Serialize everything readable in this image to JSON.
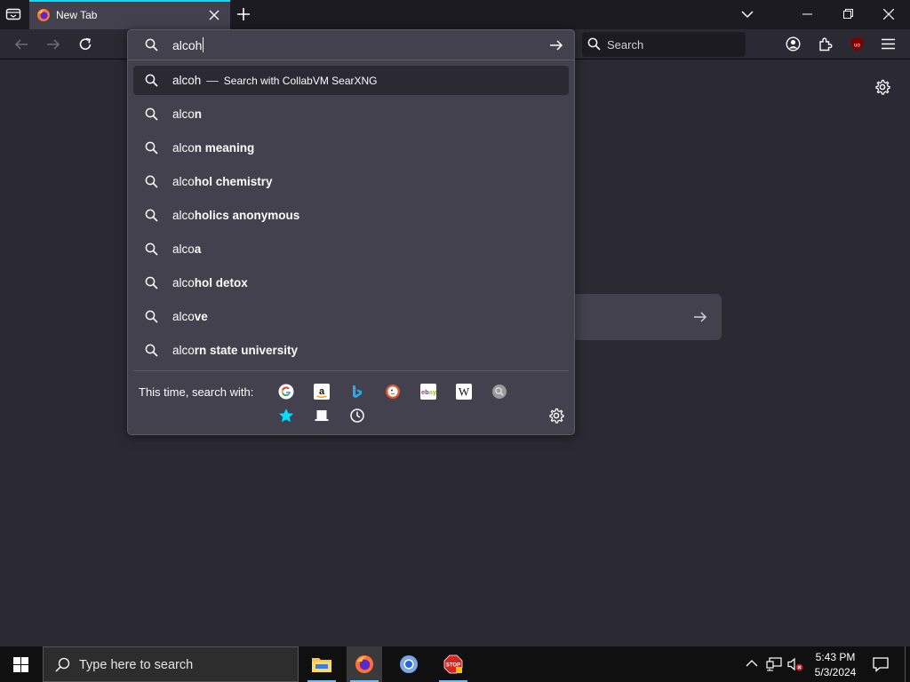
{
  "tab": {
    "title": "New Tab"
  },
  "urlbar": {
    "value": "alcoh"
  },
  "searchbar": {
    "placeholder": "Search"
  },
  "suggestions": [
    {
      "typed": "alcoh",
      "rest": "",
      "separator": "—",
      "action": "Search with CollabVM SearXNG",
      "selected": true
    },
    {
      "typed": "alco",
      "rest": "n"
    },
    {
      "typed": "alco",
      "rest": "n meaning"
    },
    {
      "typed": "alco",
      "rest": "hol chemistry"
    },
    {
      "typed": "alco",
      "rest": "holics anonymous"
    },
    {
      "typed": "alco",
      "rest": "a"
    },
    {
      "typed": "alco",
      "rest": "hol detox"
    },
    {
      "typed": "alco",
      "rest": "ve"
    },
    {
      "typed": "alco",
      "rest": "rn state university"
    }
  ],
  "oneoff": {
    "label": "This time, search with:",
    "engines": [
      "google-icon",
      "amazon-icon",
      "bing-icon",
      "duckduckgo-icon",
      "ebay-icon",
      "wikipedia-icon",
      "searxng-icon"
    ],
    "modes": [
      "bookmarks-icon",
      "tabs-icon",
      "history-icon"
    ]
  },
  "taskbar": {
    "search_placeholder": "Type here to search",
    "time": "5:43 PM",
    "date": "5/3/2024"
  },
  "colors": {
    "accent": "#00ddff",
    "popup_bg": "#42414d",
    "page_bg": "#2b2a33"
  }
}
